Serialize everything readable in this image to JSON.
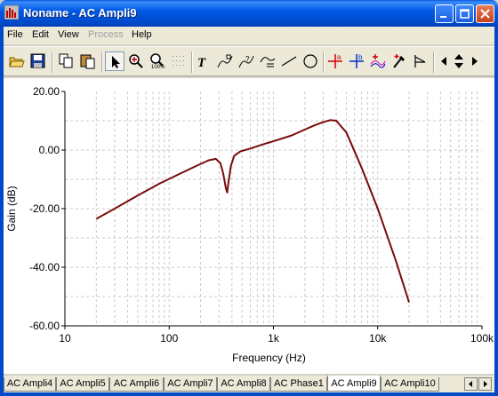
{
  "window": {
    "title": "Noname - AC Ampli9"
  },
  "menu": {
    "items": [
      {
        "label": "File",
        "enabled": true
      },
      {
        "label": "Edit",
        "enabled": true
      },
      {
        "label": "View",
        "enabled": true
      },
      {
        "label": "Process",
        "enabled": false
      },
      {
        "label": "Help",
        "enabled": true
      }
    ]
  },
  "toolbar": {
    "buttons": [
      "open-icon",
      "save-icon",
      "copy-icon",
      "paste-icon",
      "pointer-icon",
      "zoom-in-icon",
      "zoom-100-icon",
      "grid-icon",
      "text-icon",
      "label-tool-1-icon",
      "label-tool-2-icon",
      "label-tool-3-icon",
      "line-tool-icon",
      "circle-tool-icon",
      "cursor-a-icon",
      "cursor-b-icon",
      "add-curve-icon",
      "add-point-icon",
      "marker-icon",
      "left-arrow-icon",
      "up-down-arrow-icon",
      "right-arrow-icon"
    ],
    "selected": "pointer-icon"
  },
  "chart_data": {
    "type": "line",
    "xlabel": "Frequency (Hz)",
    "ylabel": "Gain (dB)",
    "xscale": "log",
    "xlim": [
      10,
      100000
    ],
    "ylim": [
      -60,
      20
    ],
    "xtick_labels": [
      "10",
      "100",
      "1k",
      "10k",
      "100k"
    ],
    "ytick_labels": [
      "20.00",
      "0.00",
      "-20.00",
      "-40.00",
      "-60.00"
    ],
    "grid": true,
    "line_color": "#7a0a0a",
    "series": [
      {
        "x": [
          20,
          30,
          50,
          80,
          120,
          180,
          240,
          280,
          310,
          330,
          350,
          360,
          370,
          390,
          420,
          480,
          600,
          800,
          1000,
          1500,
          2000,
          2500,
          3000,
          3500,
          4000,
          5000,
          7000,
          10000,
          15000,
          20000
        ],
        "y": [
          -23.5,
          -20.0,
          -15.5,
          -11.5,
          -8.5,
          -5.5,
          -3.5,
          -3.0,
          -4.5,
          -8.0,
          -13.0,
          -14.5,
          -11.0,
          -5.5,
          -2.0,
          -0.5,
          0.5,
          2.0,
          3.0,
          5.0,
          7.0,
          8.5,
          9.5,
          10.2,
          10.0,
          6.0,
          -6.0,
          -20.0,
          -38.0,
          -52.0
        ]
      }
    ]
  },
  "tabs": {
    "items": [
      "AC Ampli4",
      "AC Ampli5",
      "AC Ampli6",
      "AC Ampli7",
      "AC Ampli8",
      "AC Phase1",
      "AC Ampli9",
      "AC Ampli10"
    ],
    "active": "AC Ampli9"
  }
}
